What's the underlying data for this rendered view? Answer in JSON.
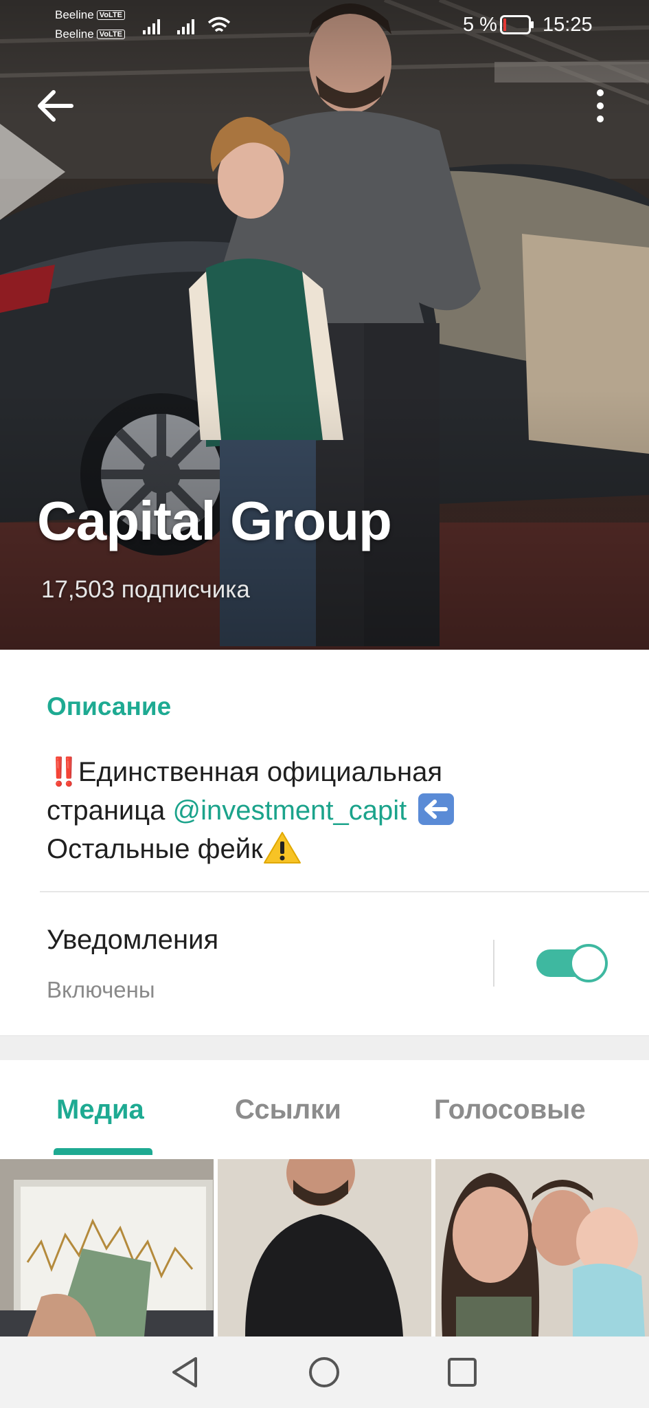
{
  "status_bar": {
    "carrier1": "Beeline",
    "carrier2": "Beeline",
    "volte": "VoLTE",
    "battery": "5 %",
    "time": "15:25"
  },
  "header": {
    "back_icon": "arrow-left-icon",
    "more_icon": "more-vertical-icon",
    "title": "Capital Group",
    "subscribers": "17,503 подписчика"
  },
  "description": {
    "label": "Описание",
    "prefix_emoji": "‼️",
    "line1": "Единственная официальная",
    "line2_text": "страница ",
    "mention": "@investment_capit",
    "line3": "Остальные фейк"
  },
  "notifications": {
    "label": "Уведомления",
    "state": "Включены",
    "enabled": true
  },
  "tabs": [
    {
      "label": "Медиа",
      "active": true
    },
    {
      "label": "Ссылки",
      "active": false
    },
    {
      "label": "Голосовые",
      "active": false
    }
  ],
  "colors": {
    "accent": "#1eaa92",
    "toggle": "#3eb8a0",
    "text": "#1f1f1f",
    "muted": "#8a8a8a"
  },
  "navbar": {
    "back_icon": "triangle-back-icon",
    "home_icon": "circle-home-icon",
    "recent_icon": "square-recents-icon"
  }
}
